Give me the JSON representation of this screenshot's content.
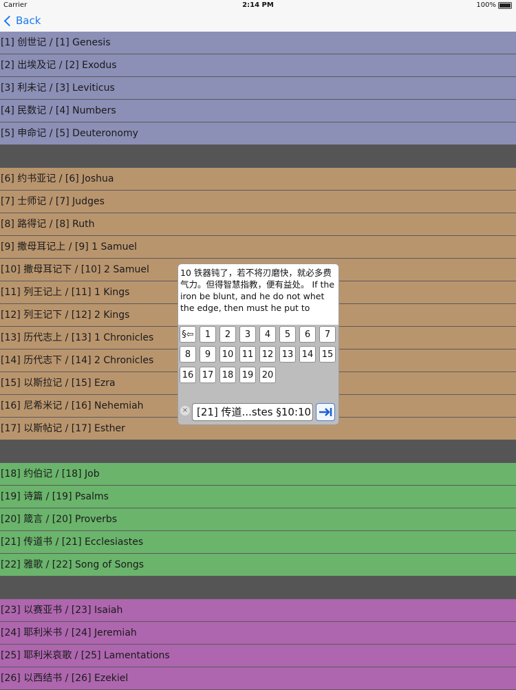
{
  "status": {
    "carrier": "Carrier",
    "time": "2:14 PM",
    "battery": "100%"
  },
  "nav": {
    "back_label": "Back"
  },
  "books": {
    "group1": [
      "[1] 创世记 / [1] Genesis",
      "[2] 出埃及记 / [2] Exodus",
      "[3] 利未记 / [3] Leviticus",
      "[4] 民数记 / [4] Numbers",
      "[5] 申命记 / [5] Deuteronomy"
    ],
    "group2": [
      "[6] 约书亚记 / [6] Joshua",
      "[7] 士师记 / [7] Judges",
      "[8] 路得记 / [8] Ruth",
      "[9] 撒母耳记上 / [9] 1 Samuel",
      "[10] 撒母耳记下 / [10] 2 Samuel",
      "[11] 列王记上 / [11] 1 Kings",
      "[12] 列王记下 / [12] 2 Kings",
      "[13] 历代志上 / [13] 1 Chronicles",
      "[14] 历代志下 / [14] 2 Chronicles",
      "[15] 以斯拉记 / [15] Ezra",
      "[16] 尼希米记 / [16] Nehemiah",
      "[17] 以斯帖记 / [17] Esther"
    ],
    "group3": [
      "[18] 约伯记 / [18] Job",
      "[19] 诗篇 / [19] Psalms",
      "[20] 箴言 / [20] Proverbs",
      "[21] 传道书 / [21] Ecclesiastes",
      "[22] 雅歌 / [22] Song of Songs"
    ],
    "group4": [
      "[23] 以赛亚书 / [23] Isaiah",
      "[24] 耶利米书 / [24] Jeremiah",
      "[25] 耶利米哀歌 / [25] Lamentations",
      "[26] 以西结书 / [26] Ezekiel"
    ]
  },
  "popup": {
    "verse_text": "10 铁器钝了，若不将刃磨快，就必多费气力。但得智慧指教，便有益处。 If the iron be blunt, and he do not whet the edge, then must he put to",
    "section_button": "§⇦",
    "numbers": [
      "1",
      "2",
      "3",
      "4",
      "5",
      "6",
      "7",
      "8",
      "9",
      "10",
      "11",
      "12",
      "13",
      "14",
      "15",
      "16",
      "17",
      "18",
      "19",
      "20"
    ],
    "clear_icon": "×",
    "reference_value": "[21] 传道...stes §10:10",
    "go_icon": "go-to-end-arrow"
  }
}
